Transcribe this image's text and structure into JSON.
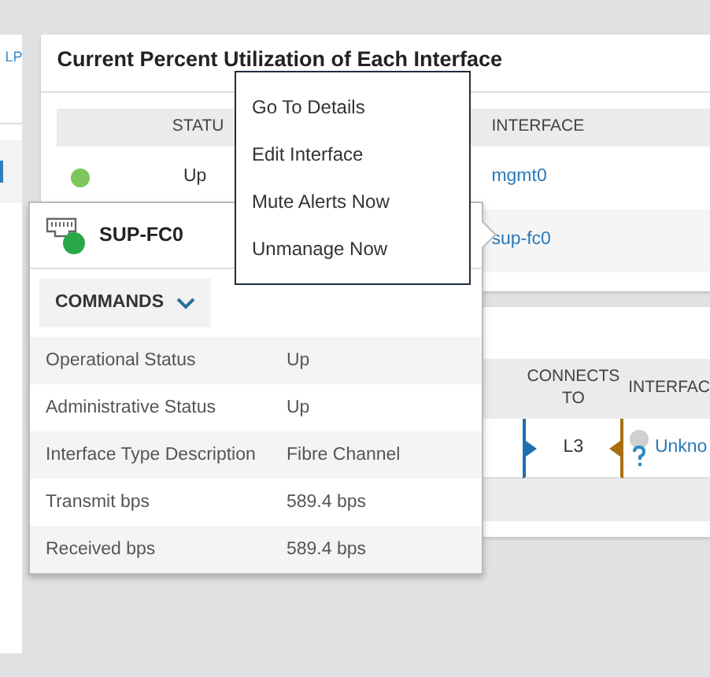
{
  "left_panel": {
    "link": "LP"
  },
  "utilization_card": {
    "title": "Current Percent Utilization of Each Interface",
    "columns": [
      "STATU",
      "INTERFACE"
    ],
    "rows": [
      {
        "status": "Up",
        "interface": "mgmt0",
        "color": "#7cc65c"
      },
      {
        "interface": "sup-fc0"
      }
    ]
  },
  "connections_card": {
    "columns": [
      "CONNECTS TO",
      "INTERFAC"
    ],
    "rows": [
      {
        "connects_to": "L3",
        "interface": "Unkno"
      }
    ]
  },
  "context_menu": {
    "items": [
      "Go To Details",
      "Edit Interface",
      "Mute Alerts Now",
      "Unmanage Now"
    ]
  },
  "popover": {
    "title": "SUP-FC0",
    "color": "#2aa848",
    "commands": "COMMANDS",
    "properties": [
      {
        "label": "Operational Status",
        "value": "Up"
      },
      {
        "label": "Administrative Status",
        "value": "Up"
      },
      {
        "label": "Interface Type Description",
        "value": "Fibre Channel"
      },
      {
        "label": "Transmit bps",
        "value": "589.4 bps"
      },
      {
        "label": "Received bps",
        "value": "589.4 bps"
      }
    ]
  }
}
